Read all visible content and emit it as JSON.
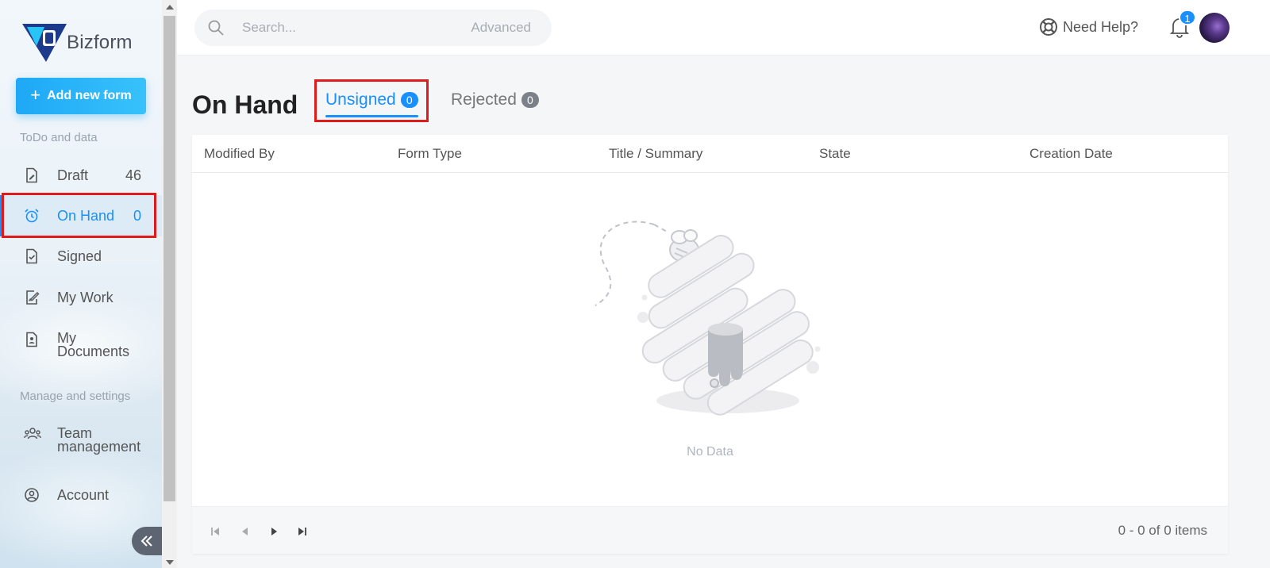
{
  "app": {
    "logo_text": "Bizform"
  },
  "sidebar": {
    "add_button_label": "Add new form",
    "section_todo": "ToDo and data",
    "section_manage": "Manage and settings",
    "items": [
      {
        "label": "Draft",
        "count": "46",
        "icon": "file-edit-icon"
      },
      {
        "label": "On Hand",
        "count": "0",
        "icon": "alarm-clock-icon",
        "active": true
      },
      {
        "label": "Signed",
        "count": "",
        "icon": "file-check-icon"
      },
      {
        "label": "My Work",
        "count": "",
        "icon": "pencil-document-icon"
      },
      {
        "label_line1": "My",
        "label_line2": "Documents",
        "count": "",
        "icon": "user-document-icon"
      },
      {
        "label_line1": "Team",
        "label_line2": "management",
        "count": "",
        "icon": "team-icon"
      },
      {
        "label": "Account",
        "count": "",
        "icon": "account-circle-icon"
      }
    ]
  },
  "header": {
    "search_placeholder": "Search...",
    "search_advanced": "Advanced",
    "help_label": "Need Help?",
    "notification_count": "1"
  },
  "main": {
    "title": "On Hand",
    "tabs": [
      {
        "label": "Unsigned",
        "count": "0",
        "active": true
      },
      {
        "label": "Rejected",
        "count": "0",
        "active": false
      }
    ],
    "table": {
      "columns": [
        "Modified By",
        "Form Type",
        "Title / Summary",
        "State",
        "Creation Date"
      ],
      "empty_text": "No Data",
      "items_summary": "0 - 0 of 0 items"
    }
  },
  "colors": {
    "accent": "#1890ff",
    "add_button": "#1ea8f6",
    "highlight": "#e01b1b"
  }
}
